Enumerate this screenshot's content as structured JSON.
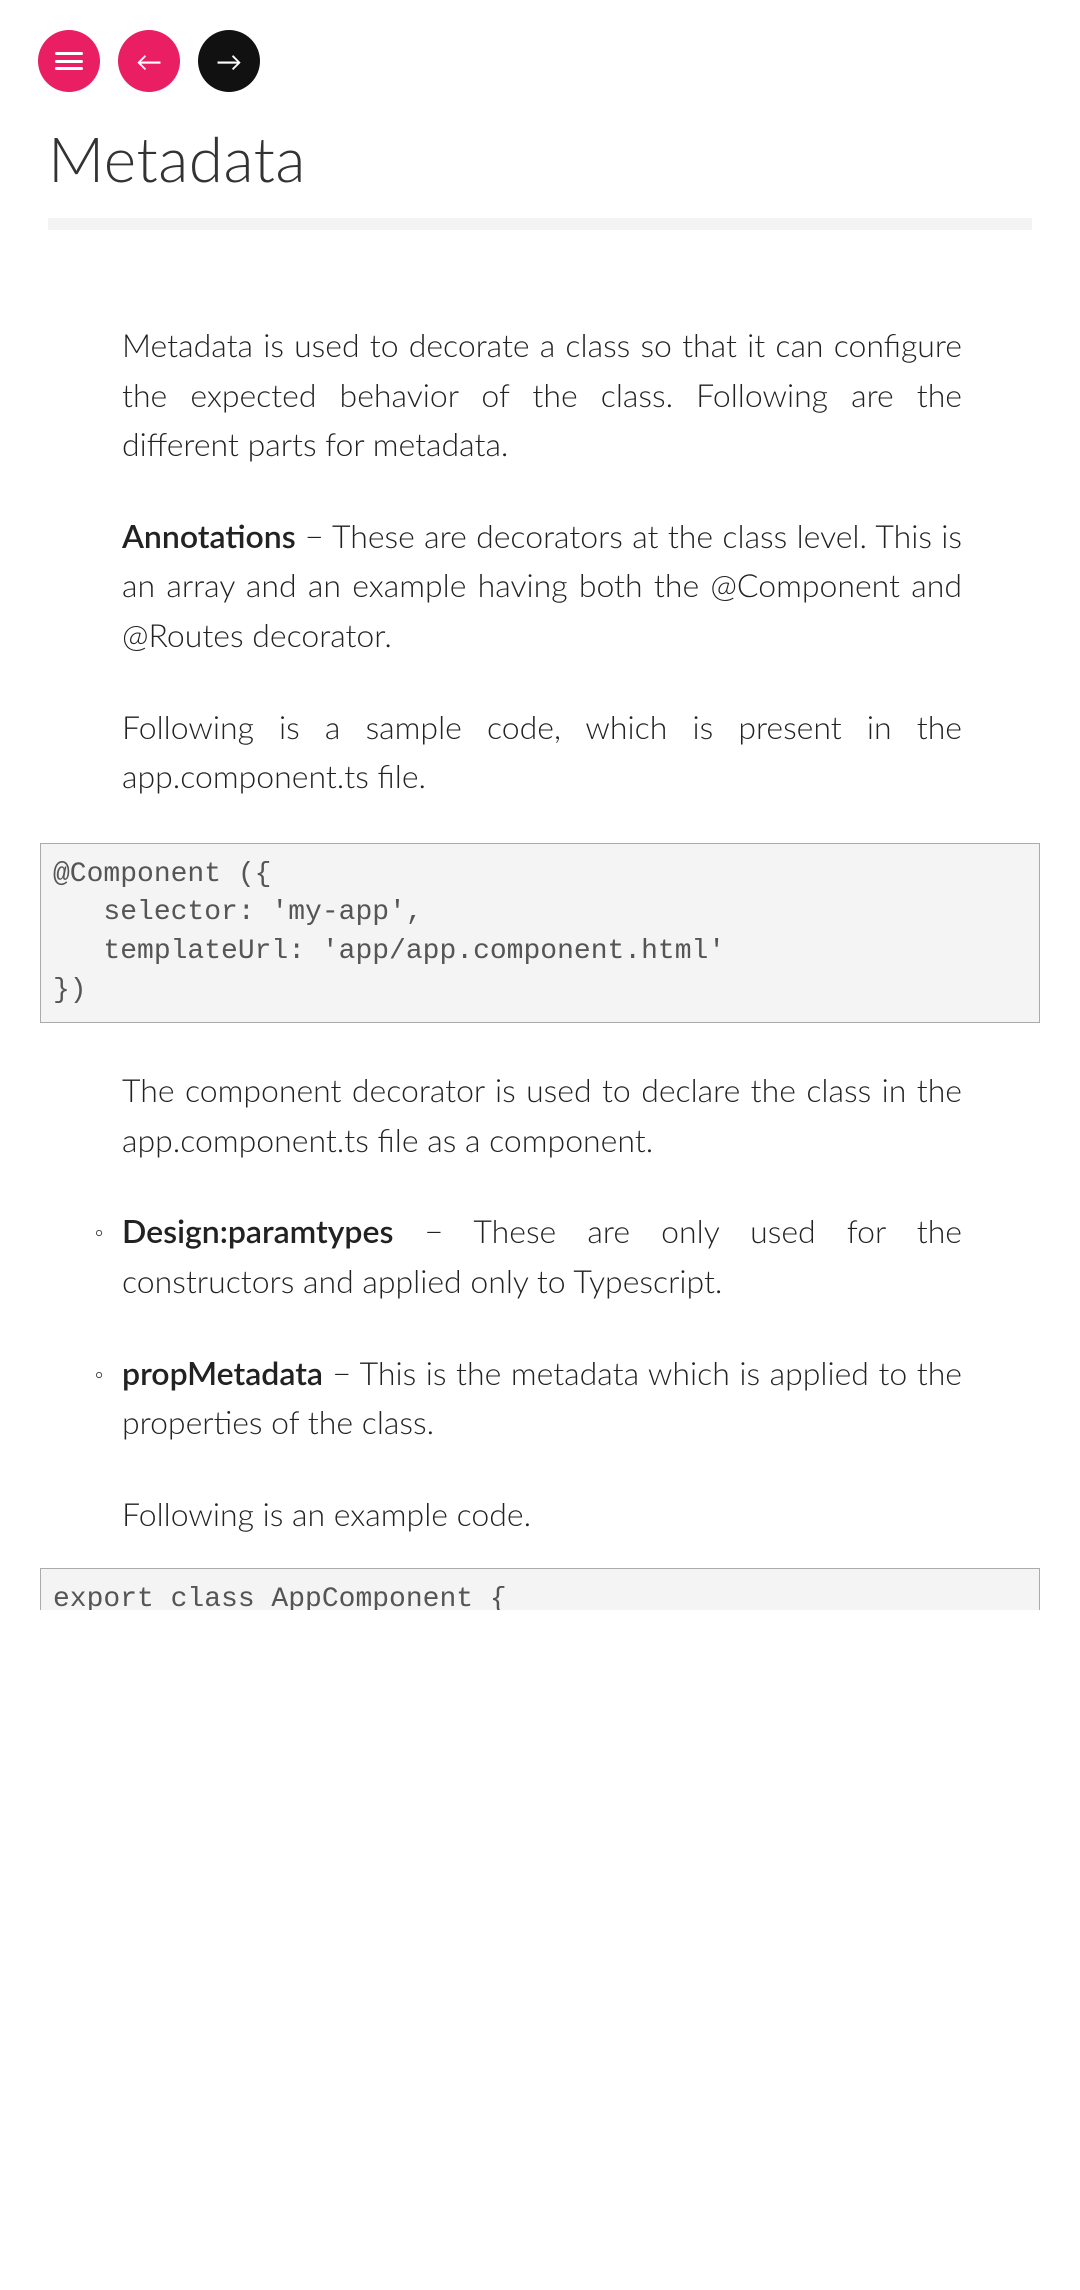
{
  "title": "Metadata",
  "p1": "Metadata is used to decorate a class so that it can configure the expected behavior of the class. Following are the different parts for metadata.",
  "p2_bold": "Annotations",
  "p2_rest": " − These are decorators at the class level. This is an array and an example having both the @Component and @Routes decorator.",
  "p3": "Following is a sample code, which is present in the app.component.ts file.",
  "code1": "@Component ({ \n   selector: 'my-app', \n   templateUrl: 'app/app.component.html' \n})",
  "p4": "The component decorator is used to declare the class in the app.component.ts file as a component.",
  "li1_bold": "Design:paramtypes",
  "li1_rest": " − These are only used for the constructors and applied only to Typescript.",
  "li2_bold": "propMetadata",
  "li2_rest": " − This is the metadata which is applied to the properties of the class.",
  "p5": "Following is an example code.",
  "code2": "export class AppComponent {"
}
